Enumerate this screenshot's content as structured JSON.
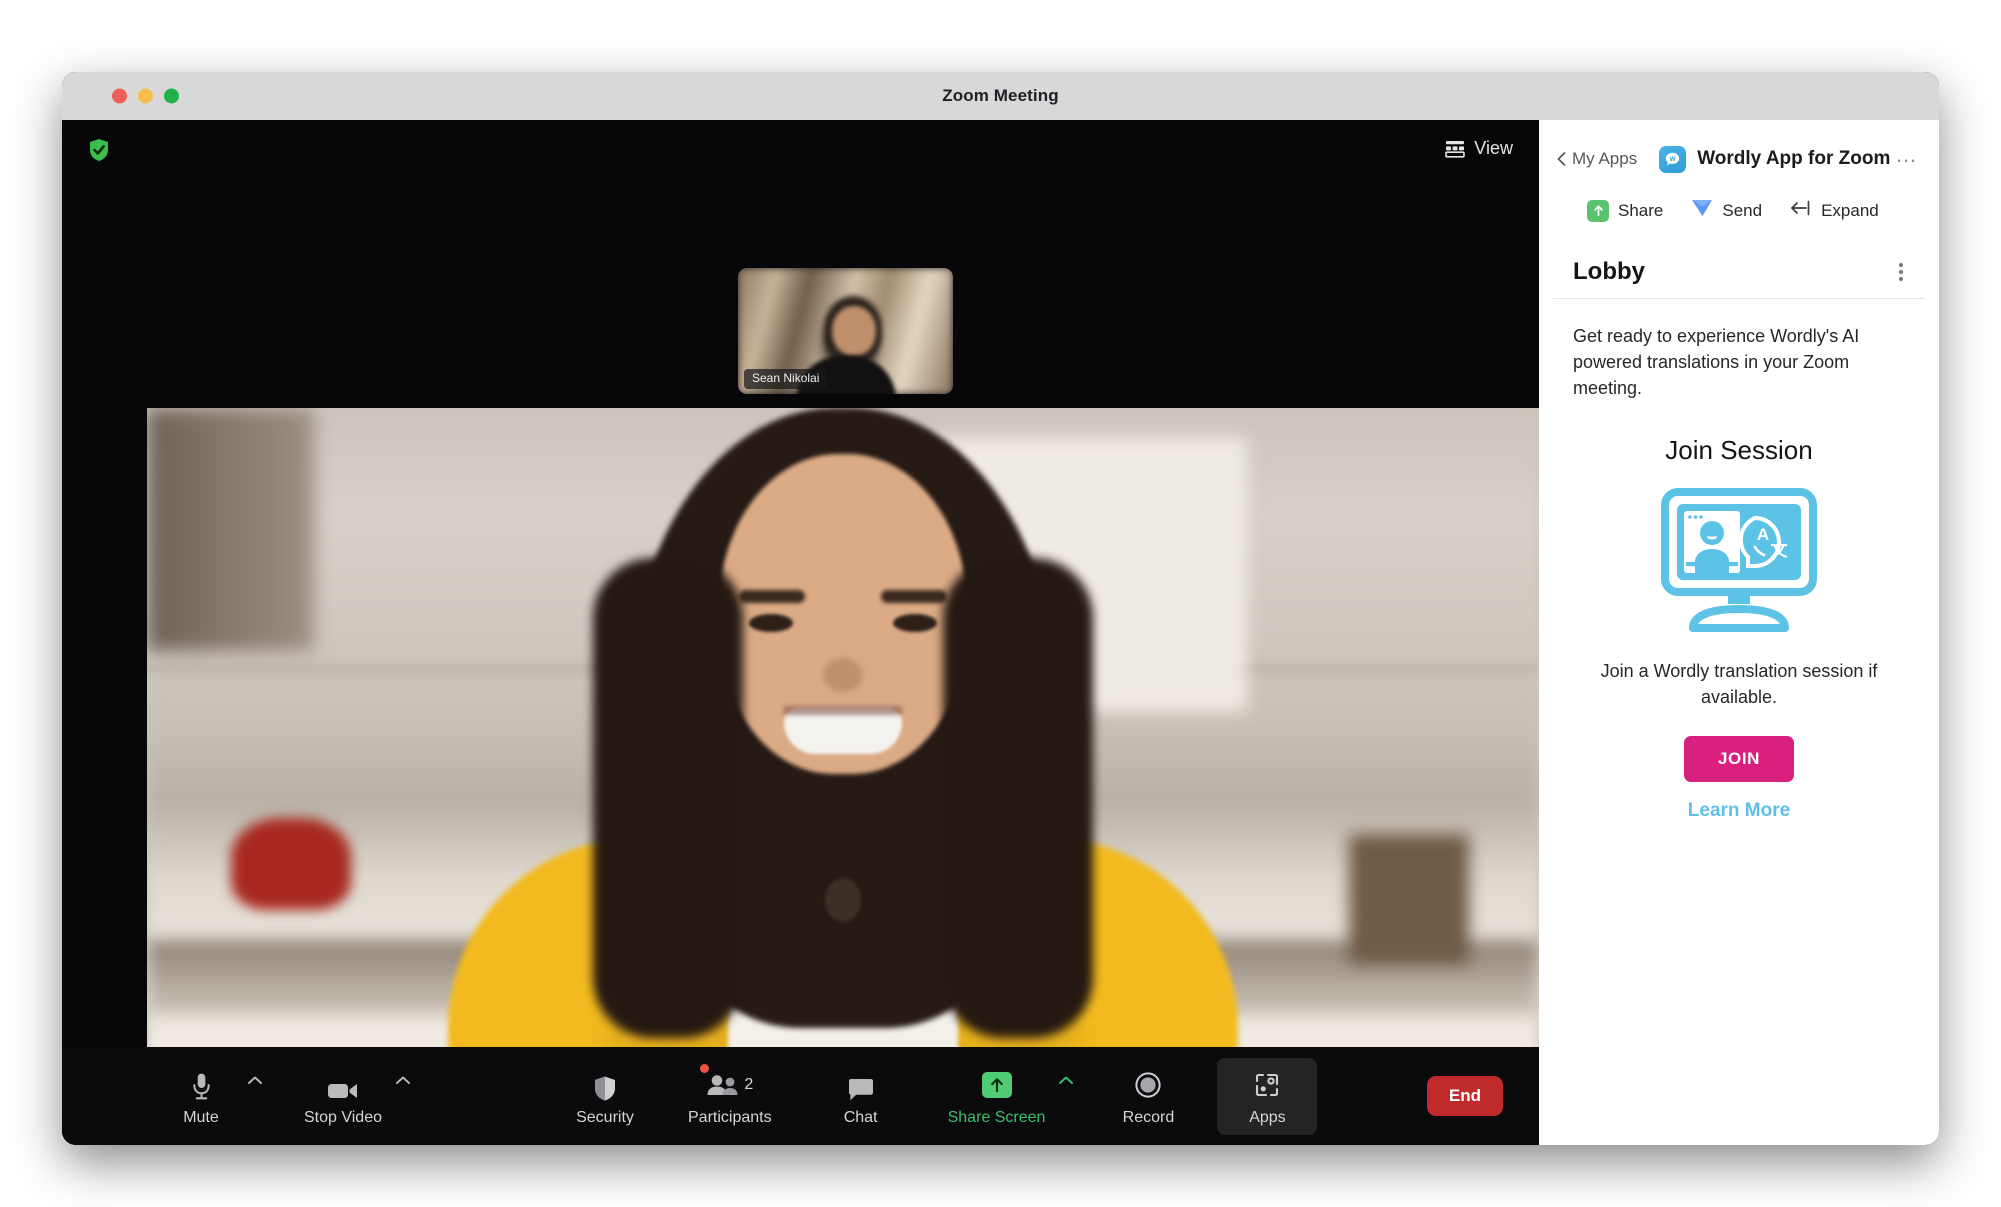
{
  "window": {
    "title": "Zoom Meeting",
    "traffic_lights": [
      "close",
      "minimize",
      "maximize"
    ]
  },
  "stage": {
    "encryption_icon": "shield-check-icon",
    "view_button": {
      "label": "View",
      "icon": "grid-view-icon"
    },
    "self_view": {
      "name": "Sean Nikolai"
    },
    "speaker": {
      "name": ""
    }
  },
  "toolbar": {
    "items": [
      {
        "id": "mute",
        "label": "Mute",
        "icon": "microphone-icon",
        "has_caret": true
      },
      {
        "id": "stop-video",
        "label": "Stop Video",
        "icon": "video-camera-icon",
        "has_caret": true
      },
      {
        "id": "security",
        "label": "Security",
        "icon": "shield-icon",
        "has_caret": false
      },
      {
        "id": "participants",
        "label": "Participants",
        "icon": "people-icon",
        "has_caret": false,
        "count": "2",
        "badge_dot": true
      },
      {
        "id": "chat",
        "label": "Chat",
        "icon": "chat-bubble-icon",
        "has_caret": false
      },
      {
        "id": "share-screen",
        "label": "Share Screen",
        "icon": "share-arrow-icon",
        "has_caret": true,
        "highlight": "green"
      },
      {
        "id": "record",
        "label": "Record",
        "icon": "record-circle-icon",
        "has_caret": false
      },
      {
        "id": "apps",
        "label": "Apps",
        "icon": "apps-icon",
        "has_caret": false,
        "active": true
      }
    ],
    "end_button": {
      "label": "End"
    }
  },
  "panel": {
    "back_label": "My Apps",
    "app_name": "Wordly App for Zoom",
    "app_icon": "wordly-logo-icon",
    "more_menu": "…",
    "actions": [
      {
        "id": "share",
        "label": "Share",
        "icon": "share-up-arrow-icon"
      },
      {
        "id": "send",
        "label": "Send",
        "icon": "paper-plane-icon"
      },
      {
        "id": "expand",
        "label": "Expand",
        "icon": "expand-arrow-icon"
      }
    ],
    "lobby": {
      "title": "Lobby",
      "kebab": "kebab-menu-icon",
      "intro": "Get ready to experience Wordly's AI powered translations in your Zoom meeting."
    },
    "join": {
      "title": "Join Session",
      "illustration": "monitor-translation-icon",
      "description": "Join a Wordly translation session if available.",
      "button_label": "JOIN",
      "link_label": "Learn More"
    }
  },
  "colors": {
    "accent_pink": "#d9207f",
    "accent_blue": "#5ec0e8",
    "share_green": "#58c46e",
    "end_red": "#c02a2a",
    "share_screen_green": "#3ac06c"
  }
}
